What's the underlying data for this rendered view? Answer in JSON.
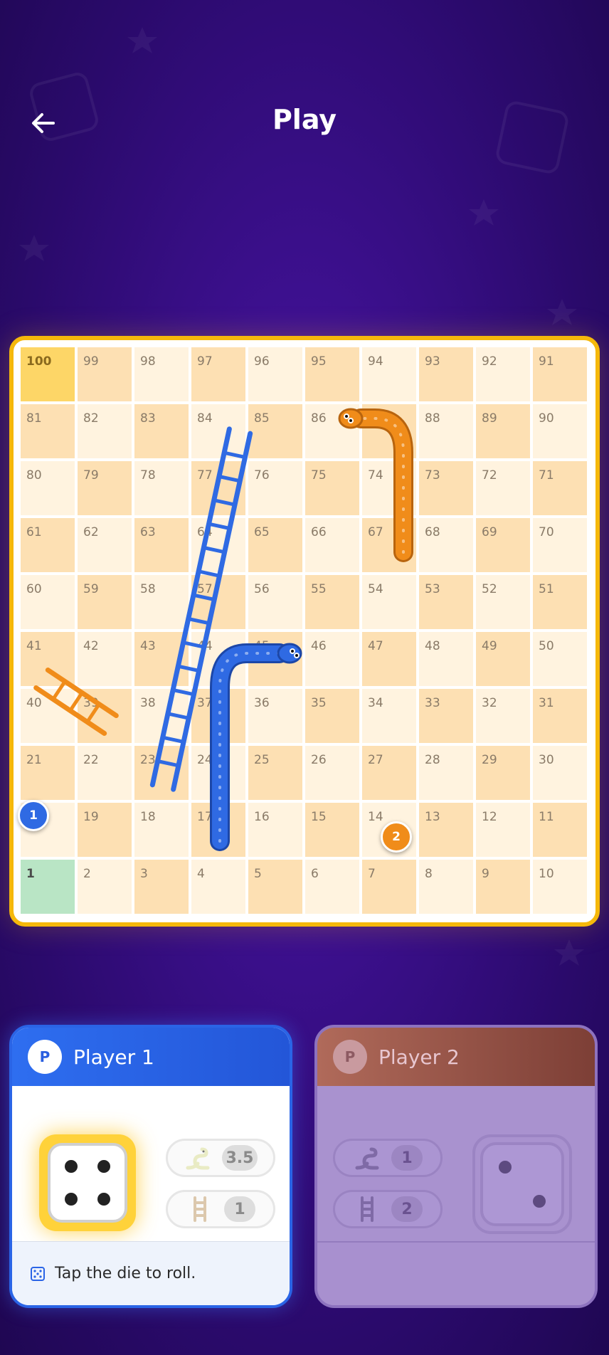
{
  "header": {
    "title": "Play",
    "back_icon": "arrow-left-icon"
  },
  "board": {
    "rows": [
      [
        100,
        99,
        98,
        97,
        96,
        95,
        94,
        93,
        92,
        91
      ],
      [
        81,
        82,
        83,
        84,
        85,
        86,
        87,
        88,
        89,
        90
      ],
      [
        80,
        79,
        78,
        77,
        76,
        75,
        74,
        73,
        72,
        71
      ],
      [
        61,
        62,
        63,
        64,
        65,
        66,
        67,
        68,
        69,
        70
      ],
      [
        60,
        59,
        58,
        57,
        56,
        55,
        54,
        53,
        52,
        51
      ],
      [
        41,
        42,
        43,
        44,
        45,
        46,
        47,
        48,
        49,
        50
      ],
      [
        40,
        39,
        38,
        37,
        36,
        35,
        34,
        33,
        32,
        31
      ],
      [
        21,
        22,
        23,
        24,
        25,
        26,
        27,
        28,
        29,
        30
      ],
      [
        20,
        19,
        18,
        17,
        16,
        15,
        14,
        13,
        12,
        11
      ],
      [
        1,
        2,
        3,
        4,
        5,
        6,
        7,
        8,
        9,
        10
      ]
    ],
    "tokens": [
      {
        "label": "1",
        "player": "Player 1",
        "color": "#2f6ae3"
      },
      {
        "label": "2",
        "player": "Player 2",
        "color": "#f08c1a"
      }
    ],
    "colors": {
      "frame": "#f5b80b",
      "start": "#b9e5c5",
      "finish": "#fdd667",
      "snake_blue": "#2f6ae3",
      "snake_orange": "#f08c1a",
      "ladder_blue": "#2f6ae3",
      "ladder_orange": "#f08c1a"
    }
  },
  "players": [
    {
      "avatar": "P",
      "name": "Player 1",
      "snake_stat": "3.5",
      "ladder_stat": "1",
      "die_value": 4,
      "hint": "Tap the die to roll.",
      "active": true
    },
    {
      "avatar": "P",
      "name": "Player 2",
      "snake_stat": "1",
      "ladder_stat": "2",
      "die_value": 2,
      "active": false
    }
  ]
}
